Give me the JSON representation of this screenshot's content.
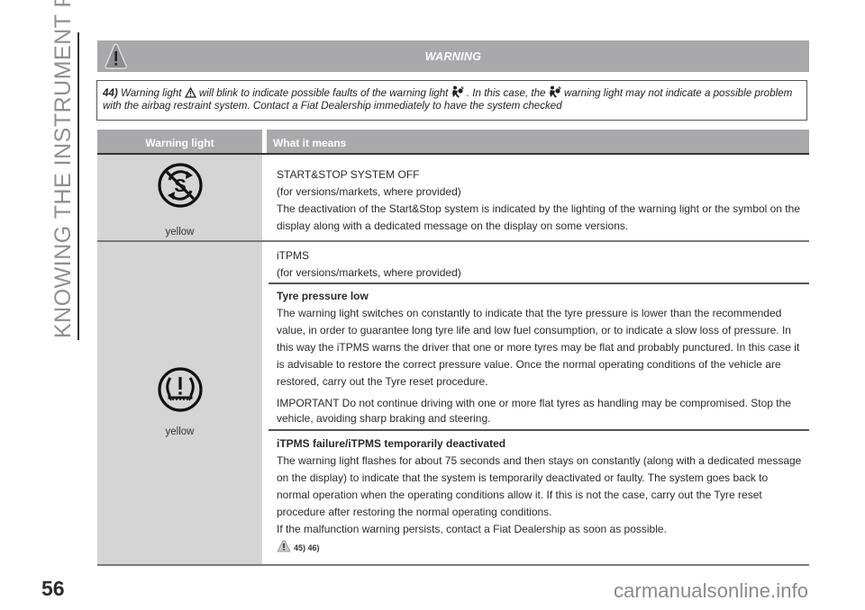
{
  "section_title": "KNOWING THE INSTRUMENT PANEL",
  "page_number": "56",
  "watermark": "carmanualsonline.info",
  "warning_box": {
    "title": "WARNING",
    "note_number": "44)",
    "note_part1": "Warning light",
    "note_part2": "will blink to indicate possible faults of the warning light",
    "note_part3": ". In this case, the",
    "note_part4": "warning light may not indicate a possible problem with the airbag restraint system. Contact a Fiat Dealership immediately to have the system checked"
  },
  "table": {
    "headers": [
      "Warning light",
      "What it means"
    ],
    "rows": [
      {
        "icon": "start-stop-off-icon",
        "color": "yellow",
        "title": "START&STOP SYSTEM OFF",
        "availability": "(for versions/markets, where provided)",
        "description": "The deactivation of the Start&Stop system is indicated by the lighting of the warning light or the symbol on the display along with a dedicated message on the display on some versions."
      },
      {
        "icon": "tyre-pressure-icon",
        "color": "yellow",
        "title": "iTPMS",
        "availability": "(for versions/markets, where provided)",
        "subsections": [
          {
            "heading": "Tyre pressure low",
            "body": "The warning light switches on constantly to indicate that the tyre pressure is lower than the recommended value, in order to guarantee long tyre life and low fuel consumption, or to indicate a slow loss of pressure. In this way the iTPMS warns the driver that one or more tyres may be flat and probably punctured. In this case it is advisable to restore the correct pressure value. Once the normal operating conditions of the vehicle are restored, carry out the Tyre reset procedure.",
            "important": "IMPORTANT Do not continue driving with one or more flat tyres as handling may be compromised. Stop the vehicle, avoiding sharp braking and steering."
          },
          {
            "heading": "iTPMS failure/iTPMS temporarily deactivated",
            "body": "The warning light flashes for about 75 seconds and then stays on constantly (along with a dedicated message on the display) to indicate that the system is temporarily deactivated or faulty. The system goes back to normal operation when the operating conditions allow it. If this is not the case, carry out the Tyre reset procedure after restoring the normal operating conditions.",
            "extra": "If the malfunction warning persists, contact a Fiat Dealership as soon as possible.",
            "refs": "45) 46)"
          }
        ]
      }
    ]
  }
}
